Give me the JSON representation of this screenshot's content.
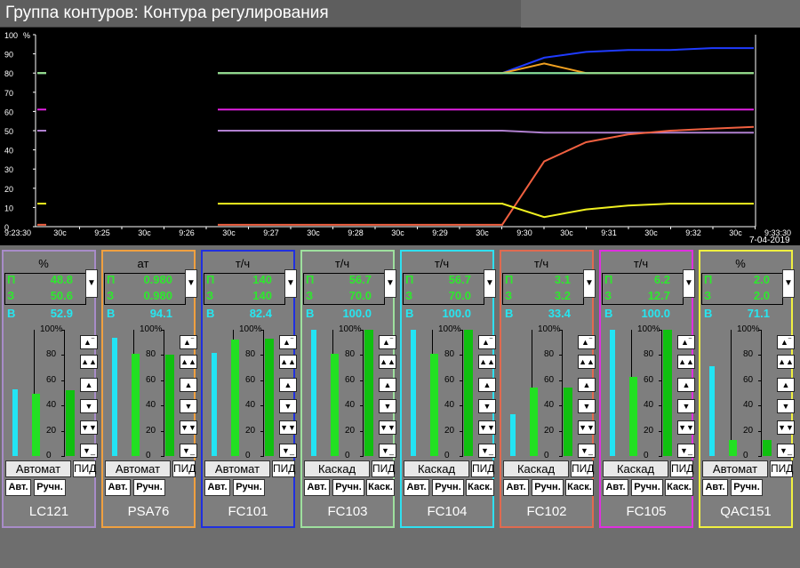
{
  "window": {
    "title": "Группа контуров: Контура регулирования"
  },
  "chart_data": {
    "type": "line",
    "y_unit": "%",
    "y_ticks": [
      "100",
      "90",
      "80",
      "70",
      "60",
      "50",
      "40",
      "30",
      "20",
      "10",
      "0"
    ],
    "ylim": [
      0,
      100
    ],
    "x_ticks": [
      "9:23:30",
      "30c",
      "9:25",
      "30c",
      "9:26",
      "30c",
      "9:27",
      "30c",
      "9:28",
      "30c",
      "9:29",
      "30c",
      "9:30",
      "30c",
      "9:31",
      "30c",
      "9:32",
      "30c",
      "9:33:30"
    ],
    "date": "7-04-2019",
    "grid": false,
    "series": [
      {
        "color": "#1f3bff",
        "values": [
          80,
          80,
          80,
          80,
          80,
          80,
          80,
          80,
          80,
          80,
          80,
          80,
          80,
          88,
          91,
          92,
          92,
          93,
          93
        ]
      },
      {
        "color": "#22c4ff",
        "values": [
          80,
          80,
          80,
          80,
          80,
          80,
          80,
          80,
          80,
          80,
          80,
          80,
          80,
          80,
          80,
          80,
          80,
          80,
          80
        ]
      },
      {
        "color": "#f0a020",
        "values": [
          80,
          80,
          80,
          80,
          80,
          80,
          80,
          80,
          80,
          80,
          80,
          80,
          80,
          85,
          80,
          80,
          80,
          80,
          80
        ]
      },
      {
        "color": "#90e090",
        "values": [
          80,
          80,
          80,
          80,
          80,
          80,
          80,
          80,
          80,
          80,
          80,
          80,
          80,
          80,
          80,
          80,
          80,
          80,
          80
        ]
      },
      {
        "color": "#e020e0",
        "values": [
          61,
          61,
          61,
          61,
          61,
          61,
          61,
          61,
          61,
          61,
          61,
          61,
          61,
          61,
          61,
          61,
          61,
          61,
          61
        ]
      },
      {
        "color": "#b080d0",
        "values": [
          50,
          50,
          50,
          50,
          50,
          50,
          50,
          50,
          50,
          50,
          50,
          50,
          50,
          49,
          49,
          49,
          49,
          49,
          49
        ]
      },
      {
        "color": "#f06040",
        "values": [
          1,
          1,
          1,
          1,
          1,
          1,
          1,
          1,
          1,
          1,
          1,
          1,
          1,
          34,
          44,
          48,
          50,
          51,
          52
        ]
      },
      {
        "color": "#f0f020",
        "values": [
          12,
          12,
          12,
          12,
          12,
          12,
          12,
          12,
          12,
          12,
          12,
          12,
          12,
          5,
          9,
          11,
          12,
          12,
          12
        ]
      }
    ]
  },
  "panels": [
    {
      "tag": "LC121",
      "unit": "%",
      "p": "48.8",
      "z": "50.6",
      "v": "52.9",
      "mode": "Автомат",
      "pid": "ПИД",
      "border": "#a88cc8",
      "pv_pct": 53,
      "sp_pct": 49,
      "out_pct": 52,
      "buttons": [
        "Авт.",
        "Ручн."
      ]
    },
    {
      "tag": "PSA76",
      "unit": "ат",
      "p": "0.980",
      "z": "0.980",
      "v": "94.1",
      "mode": "Автомат",
      "pid": "ПИД",
      "border": "#f0a040",
      "pv_pct": 94,
      "sp_pct": 81,
      "out_pct": 80,
      "buttons": [
        "Авт.",
        "Ручн."
      ]
    },
    {
      "tag": "FC101",
      "unit": "т/ч",
      "p": "140",
      "z": "140",
      "v": "82.4",
      "mode": "Автомат",
      "pid": "ПИД",
      "border": "#2030e0",
      "pv_pct": 82,
      "sp_pct": 92,
      "out_pct": 93,
      "buttons": [
        "Авт.",
        "Ручн."
      ]
    },
    {
      "tag": "FC103",
      "unit": "т/ч",
      "p": "56.7",
      "z": "70.0",
      "v": "100.0",
      "mode": "Каскад",
      "pid": "ПИД",
      "border": "#9ee09e",
      "pv_pct": 100,
      "sp_pct": 81,
      "out_pct": 100,
      "buttons": [
        "Авт.",
        "Ручн.",
        "Каск."
      ]
    },
    {
      "tag": "FC104",
      "unit": "т/ч",
      "p": "56.7",
      "z": "70.0",
      "v": "100.0",
      "mode": "Каскад",
      "pid": "ПИД",
      "border": "#30e0f0",
      "pv_pct": 100,
      "sp_pct": 81,
      "out_pct": 100,
      "buttons": [
        "Авт.",
        "Ручн.",
        "Каск."
      ]
    },
    {
      "tag": "FC102",
      "unit": "т/ч",
      "p": "3.1",
      "z": "3.2",
      "v": "33.4",
      "mode": "Каскад",
      "pid": "ПИД",
      "border": "#e06a50",
      "pv_pct": 33,
      "sp_pct": 54,
      "out_pct": 54,
      "buttons": [
        "Авт.",
        "Ручн.",
        "Каск."
      ]
    },
    {
      "tag": "FC105",
      "unit": "т/ч",
      "p": "6.2",
      "z": "12.7",
      "v": "100.0",
      "mode": "Каскад",
      "pid": "ПИД",
      "border": "#e030e0",
      "pv_pct": 100,
      "sp_pct": 63,
      "out_pct": 100,
      "buttons": [
        "Авт.",
        "Ручн.",
        "Каск."
      ]
    },
    {
      "tag": "QAC151",
      "unit": "%",
      "p": "2.0",
      "z": "2.0",
      "v": "71.1",
      "mode": "Автомат",
      "pid": "ПИД",
      "border": "#f0f040",
      "pv_pct": 71,
      "sp_pct": 13,
      "out_pct": 13,
      "buttons": [
        "Авт.",
        "Ручн."
      ]
    }
  ],
  "labels": {
    "p": "П",
    "z": "З",
    "v": "В",
    "scale": [
      "100%",
      "80",
      "60",
      "40",
      "20",
      "0"
    ]
  },
  "icons": {
    "dropdown": "chevron-down-icon",
    "top": "move-to-top-icon",
    "up_fast": "double-up-icon",
    "up": "up-icon",
    "down": "down-icon",
    "down_fast": "double-down-icon",
    "bottom": "move-to-bottom-icon"
  }
}
